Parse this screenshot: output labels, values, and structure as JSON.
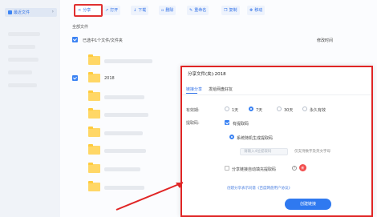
{
  "sidebar": {
    "active_label": "最近文件",
    "chevron": "›"
  },
  "toolbar": {
    "share": "分享",
    "open": "打开",
    "download": "下载",
    "delete": "删除",
    "rename": "重命名",
    "copy": "复制",
    "move": "移动"
  },
  "breadcrumb": "全部文件",
  "filebar": {
    "selection_text": "已选中1个文件/文件夹",
    "column_modified": "修改时间"
  },
  "rows": [
    {
      "name": "2018"
    }
  ],
  "dialog": {
    "title": "分享文件(夹):2018",
    "tabs": [
      "链接分享",
      "发给网盘好友"
    ],
    "validity_label": "有效期:",
    "validity_options": [
      "1天",
      "7天",
      "30天",
      "永久有效"
    ],
    "code_label": "提取码:",
    "code_checkbox": "有提取码",
    "system_random": "系统随机生成提取码",
    "custom_placeholder": "请输入4位提取码",
    "custom_hint": "仅支持数字及英文字母",
    "auto_fill": "分享链接自动填充提取码",
    "badge": "新",
    "footer_note": "创建分享表示同意《百度网盘用户协议》",
    "create_button": "创建链接"
  },
  "colors": {
    "accent": "#2f79f0",
    "highlight": "#e02525",
    "folder": "#ffd766"
  }
}
